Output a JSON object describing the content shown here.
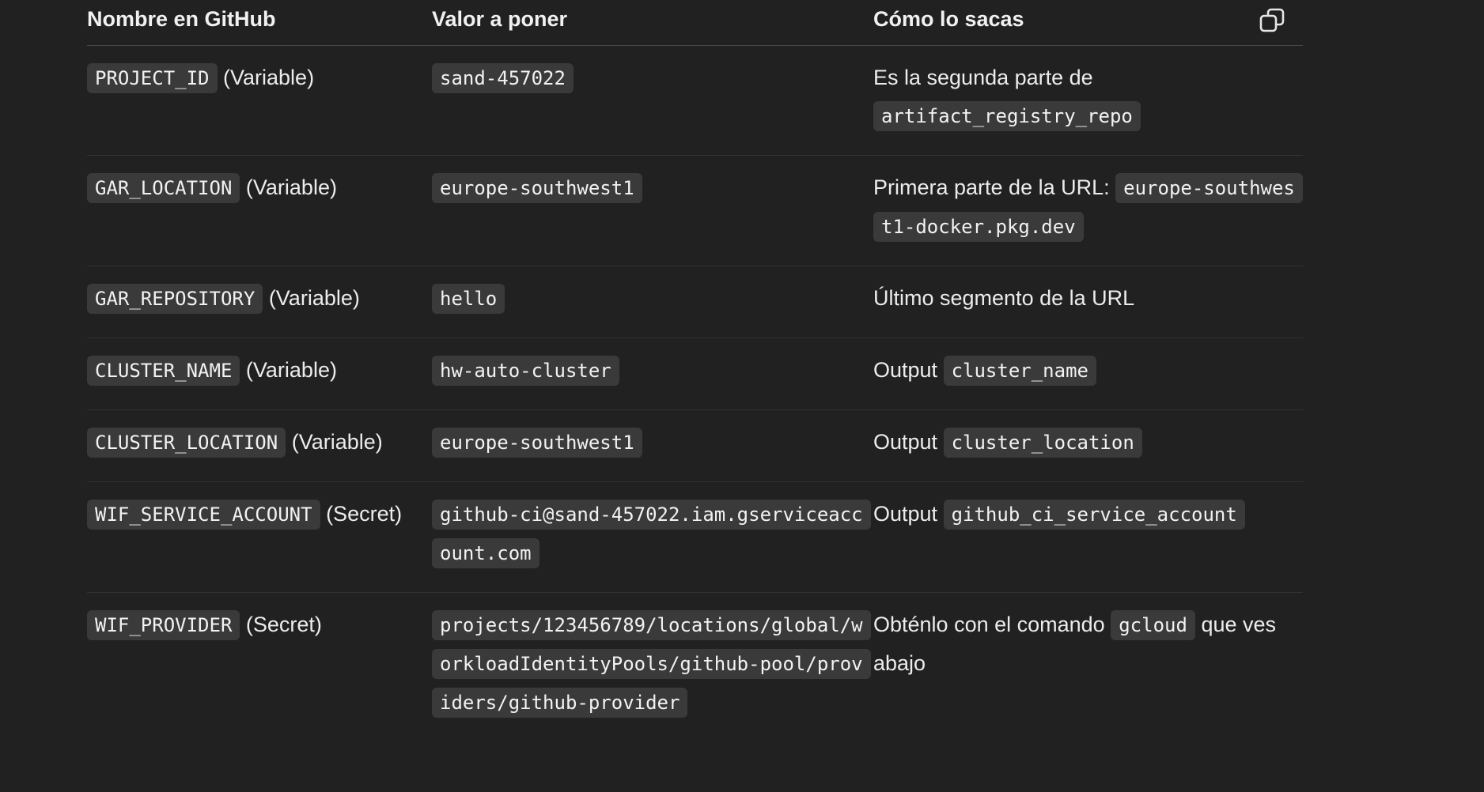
{
  "table": {
    "headers": [
      "Nombre en GitHub",
      "Valor a poner",
      "Cómo lo sacas"
    ],
    "copy_icon": "copy-icon",
    "rows": [
      {
        "name_code": "PROJECT_ID",
        "name_type": "(Variable)",
        "value": "sand-457022",
        "how_text": "Es la segunda parte de",
        "how_code": "artifact_registry_repo",
        "how_suffix": ""
      },
      {
        "name_code": "GAR_LOCATION",
        "name_type": "(Variable)",
        "value": "europe-southwest1",
        "how_text": "Primera parte de la URL:",
        "how_code": "europe-southwest1-docker.pkg.dev",
        "how_suffix": ""
      },
      {
        "name_code": "GAR_REPOSITORY",
        "name_type": "(Variable)",
        "value": "hello",
        "how_text": "Último segmento de la URL",
        "how_code": "",
        "how_suffix": ""
      },
      {
        "name_code": "CLUSTER_NAME",
        "name_type": "(Variable)",
        "value": "hw-auto-cluster",
        "how_text": "Output",
        "how_code": "cluster_name",
        "how_suffix": ""
      },
      {
        "name_code": "CLUSTER_LOCATION",
        "name_type": "(Variable)",
        "value": "europe-southwest1",
        "how_text": "Output",
        "how_code": "cluster_location",
        "how_suffix": ""
      },
      {
        "name_code": "WIF_SERVICE_ACCOUNT",
        "name_type": "(Secret)",
        "value": "github-ci@sand-457022.iam.gserviceaccount.com",
        "how_text": "Output",
        "how_code": "github_ci_service_account",
        "how_suffix": ""
      },
      {
        "name_code": "WIF_PROVIDER",
        "name_type": "(Secret)",
        "value": "projects/123456789/locations/global/workloadIdentityPools/github-pool/providers/github-provider",
        "how_text": "Obténlo con el comando",
        "how_code": "gcloud",
        "how_suffix": "que ves abajo"
      }
    ]
  }
}
